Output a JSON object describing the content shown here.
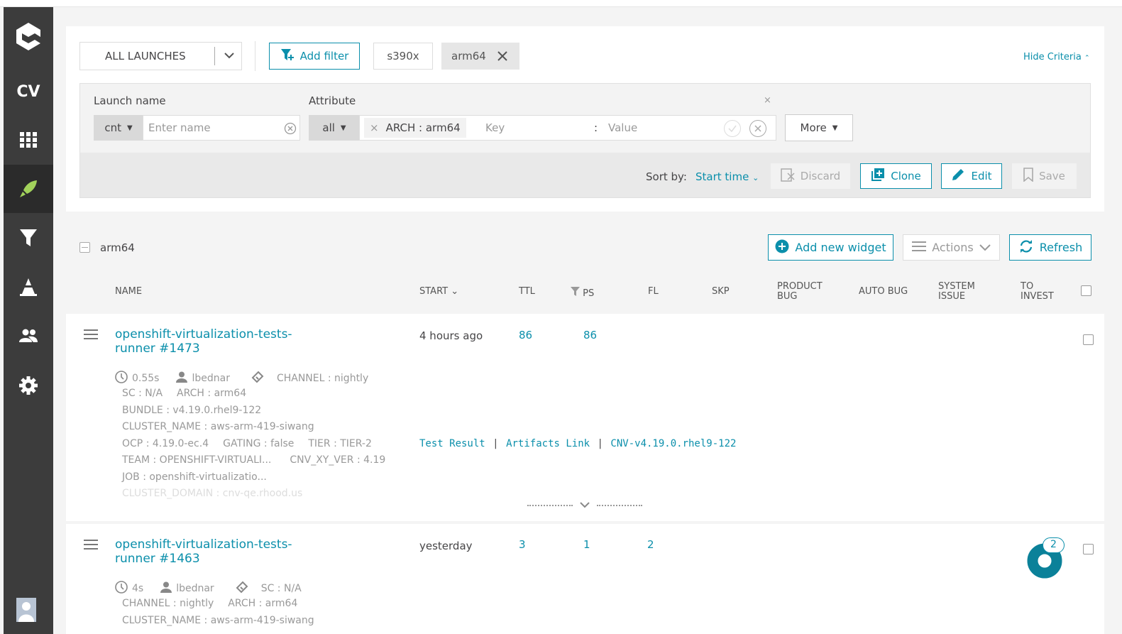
{
  "sidebar": {
    "items": [
      {
        "name": "logo"
      },
      {
        "name": "project",
        "label": "CV"
      },
      {
        "name": "dashboards"
      },
      {
        "name": "launches"
      },
      {
        "name": "filters"
      },
      {
        "name": "debug"
      },
      {
        "name": "members"
      },
      {
        "name": "settings"
      },
      {
        "name": "user-avatar"
      }
    ]
  },
  "filter_bar": {
    "launches_select": "ALL LAUNCHES",
    "add_filter": "Add filter",
    "tabs": [
      "s390x",
      "arm64"
    ],
    "hide_criteria": "Hide Criteria"
  },
  "criteria": {
    "launch_name_label": "Launch name",
    "launch_name_condition": "cnt",
    "launch_name_placeholder": "Enter name",
    "attribute_label": "Attribute",
    "attribute_condition": "all",
    "attribute_tag": "ARCH : arm64",
    "key_placeholder": "Key",
    "value_placeholder": "Value",
    "separator": ":",
    "more": "More",
    "sort_by_label": "Sort by:",
    "sort_by_value": "Start time",
    "discard": "Discard",
    "clone": "Clone",
    "edit": "Edit",
    "save": "Save"
  },
  "list": {
    "filter_name": "arm64",
    "add_widget": "Add new widget",
    "actions": "Actions",
    "refresh": "Refresh",
    "columns": {
      "name": "NAME",
      "start": "START",
      "ttl": "TTL",
      "ps": "PS",
      "fl": "FL",
      "skp": "SKP",
      "product_bug": "PRODUCT BUG",
      "auto_bug": "AUTO BUG",
      "system_issue": "SYSTEM ISSUE",
      "to_invest": "TO INVEST"
    },
    "launches": [
      {
        "name": "openshift-virtualization-tests-runner #1473",
        "start": "4 hours ago",
        "ttl": "86",
        "ps": "86",
        "fl": "",
        "duration": "0.55s",
        "owner": "lbednar",
        "attrs": [
          "CHANNEL : nightly",
          "SC : N/A",
          "ARCH : arm64",
          "BUNDLE : v4.19.0.rhel9-122",
          "CLUSTER_NAME : aws-arm-419-siwang",
          "OCP : 4.19.0-ec.4",
          "GATING : false",
          "TIER : TIER-2",
          "TEAM : OPENSHIFT-VIRTUALI...",
          "CNV_XY_VER : 4.19",
          "JOB : openshift-virtualizatio...",
          "CLUSTER_DOMAIN : cnv-qe.rhood.us"
        ],
        "links": [
          "Test Result",
          "Artifacts Link",
          "CNV-v4.19.0.rhel9-122"
        ],
        "link_sep": "|"
      },
      {
        "name": "openshift-virtualization-tests-runner #1463",
        "start": "yesterday",
        "ttl": "3",
        "ps": "1",
        "fl": "2",
        "duration": "4s",
        "owner": "lbednar",
        "attrs": [
          "SC : N/A",
          "CHANNEL : nightly",
          "ARCH : arm64",
          "CLUSTER_NAME : aws-arm-419-siwang"
        ],
        "to_invest": "2"
      }
    ]
  },
  "colors": {
    "accent": "#0b8fab",
    "sidebar": "#3c3c3c",
    "launches_active": "#a2d25b"
  }
}
